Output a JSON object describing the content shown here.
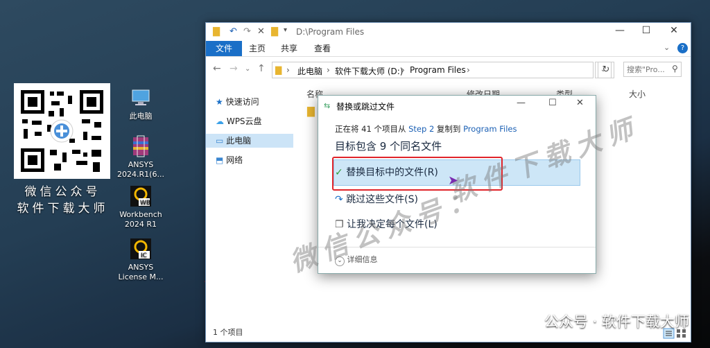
{
  "desktop": {
    "icons": [
      {
        "label": "此电脑"
      },
      {
        "label": "ANSYS 2024.R1(6..."
      },
      {
        "label": "Workbench 2024 R1"
      },
      {
        "label": "ANSYS License M..."
      }
    ],
    "qr_caption_line1": "微信公众号",
    "qr_caption_line2": "软件下载大师"
  },
  "explorer": {
    "title_path": "D:\\Program Files",
    "ribbon_tabs": [
      "文件",
      "主页",
      "共享",
      "查看"
    ],
    "breadcrumb": [
      "此电脑",
      "软件下载大师 (D:)",
      "Program Files"
    ],
    "search_placeholder": "搜索\"Pro...",
    "nav_items": [
      "快速访问",
      "WPS云盘",
      "此电脑",
      "网络"
    ],
    "columns": [
      "名称",
      "修改日期",
      "类型",
      "大小"
    ],
    "status": "1 个项目"
  },
  "dialog": {
    "title": "替换或跳过文件",
    "progress_prefix": "正在将 41 个项目从 ",
    "progress_from": "Step 2",
    "progress_mid": " 复制到 ",
    "progress_to": "Program Files",
    "heading": "目标包含 9 个同名文件",
    "option_replace": "替换目标中的文件(R)",
    "option_skip": "跳过这些文件(S)",
    "option_decide": "让我决定每个文件(L)",
    "details": "详细信息"
  },
  "watermarks": {
    "line_a": "软件下载大师",
    "line_b": "微信公众号："
  },
  "footer": "公众号 · 软件下载大师",
  "colors": {
    "accent": "#1a6fc7",
    "highlight": "#e0242a",
    "selected": "#cde6f7"
  }
}
